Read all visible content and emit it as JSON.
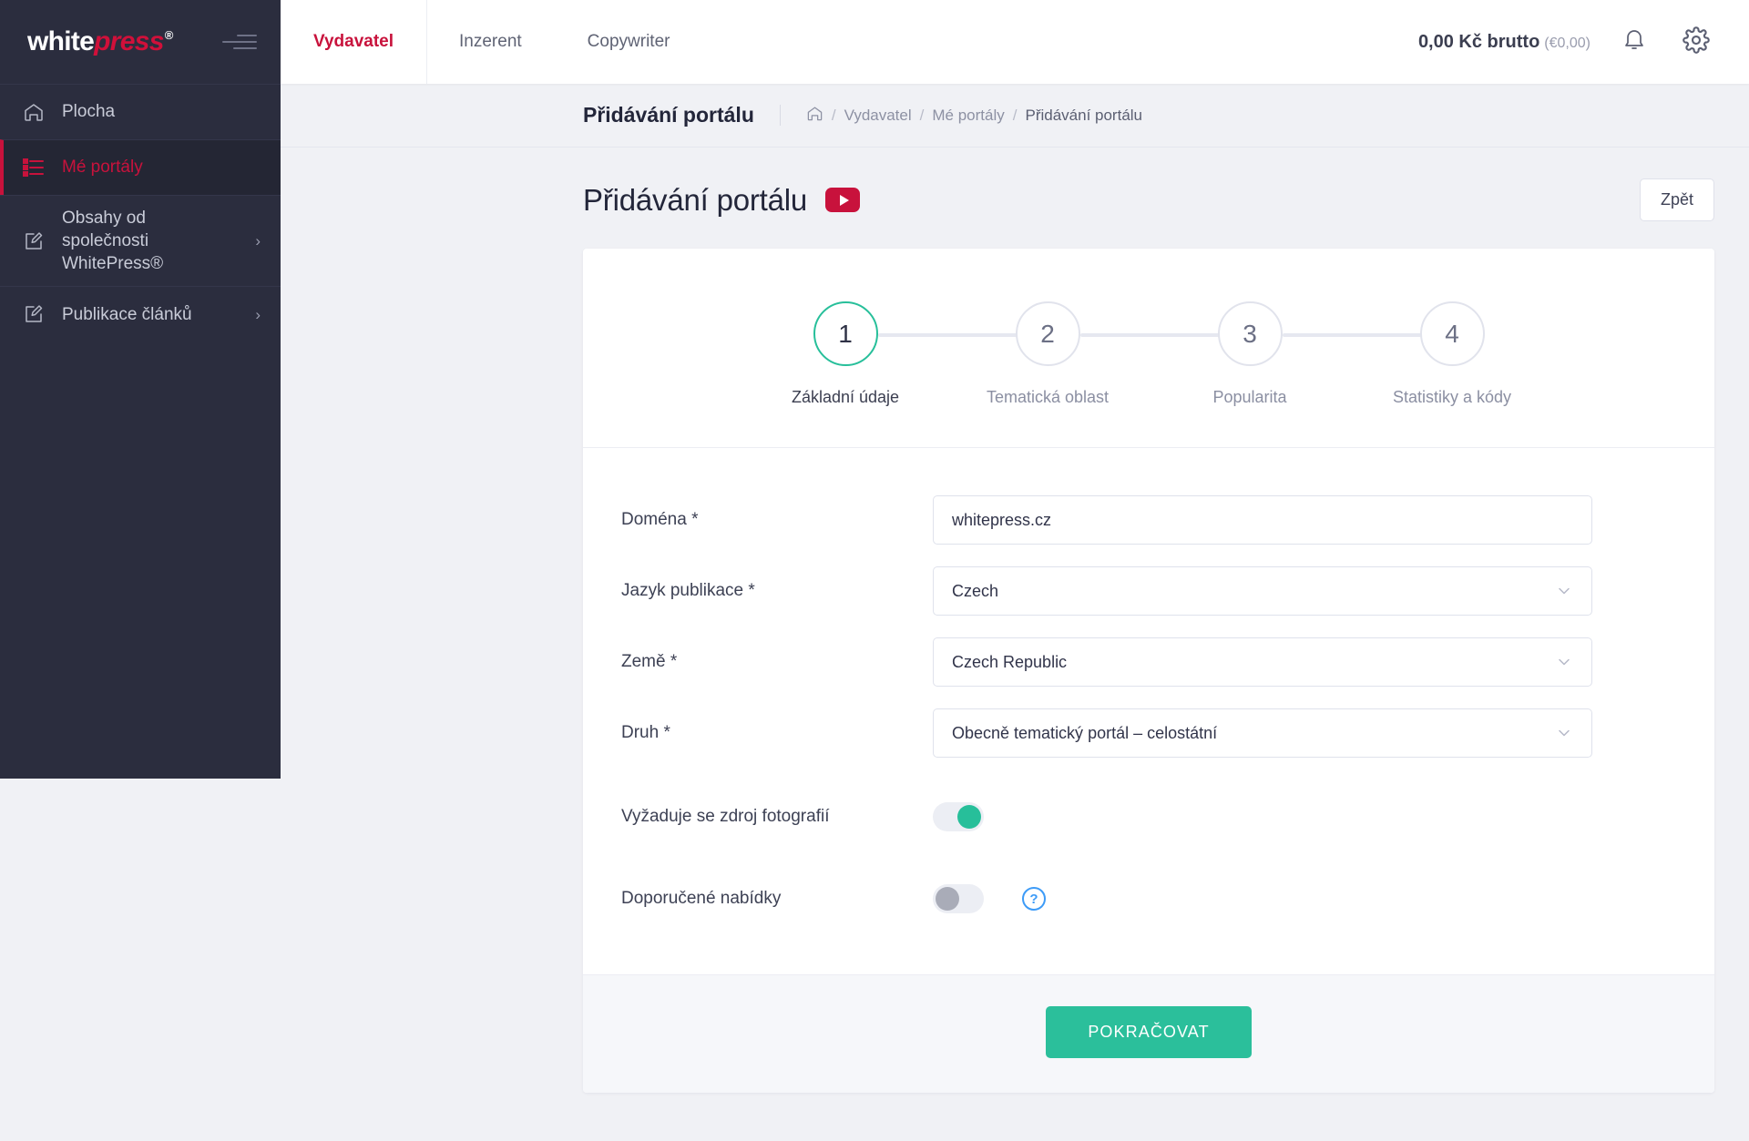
{
  "brand": {
    "logo_white": "white",
    "logo_press": "press",
    "logo_reg": "®",
    "accent_red": "#c8123c",
    "accent_green": "#2bbf9b",
    "sidebar_bg": "#2b2d3e"
  },
  "sidebar": {
    "menu_icon": "hamburger-icon",
    "items": [
      {
        "label": "Plocha",
        "icon": "home-icon",
        "active": false,
        "has_chevron": false
      },
      {
        "label": "Mé portály",
        "icon": "list-icon",
        "active": true,
        "has_chevron": false
      },
      {
        "label": "Obsahy od společnosti WhitePress®",
        "icon": "edit-icon",
        "active": false,
        "has_chevron": true,
        "chevron": "›"
      },
      {
        "label": "Publikace článků",
        "icon": "edit-icon",
        "active": false,
        "has_chevron": true,
        "chevron": "›"
      }
    ]
  },
  "topbar": {
    "tabs": [
      {
        "label": "Vydavatel",
        "active": true
      },
      {
        "label": "Inzerent",
        "active": false
      },
      {
        "label": "Copywriter",
        "active": false
      }
    ],
    "balance": "0,00 Kč brutto",
    "balance_secondary": "(€0,00)",
    "notification_icon": "bell-icon",
    "settings_icon": "gear-icon"
  },
  "page_band": {
    "title": "Přidávání portálu",
    "breadcrumb": {
      "home_icon": "home-icon",
      "items": [
        "Vydavatel",
        "Mé portály"
      ],
      "current": "Přidávání portálu",
      "separator": "/"
    }
  },
  "header": {
    "title": "Přidávání portálu",
    "video_icon": "youtube-play-icon",
    "back_label": "Zpět"
  },
  "stepper": {
    "steps": [
      {
        "number": "1",
        "label": "Základní údaje",
        "active": true
      },
      {
        "number": "2",
        "label": "Tematická oblast",
        "active": false
      },
      {
        "number": "3",
        "label": "Popularita",
        "active": false
      },
      {
        "number": "4",
        "label": "Statistiky a kódy",
        "active": false
      }
    ]
  },
  "form": {
    "fields": [
      {
        "label": "Doména *",
        "value": "whitepress.cz",
        "type": "text",
        "name": "domain"
      },
      {
        "label": "Jazyk publikace *",
        "value": "Czech",
        "type": "select",
        "name": "publication-language"
      },
      {
        "label": "Země *",
        "value": "Czech Republic",
        "type": "select",
        "name": "country"
      },
      {
        "label": "Druh *",
        "value": "Obecně tematický portál – celostátní",
        "type": "select",
        "name": "portal-type"
      }
    ],
    "toggles": [
      {
        "label": "Vyžaduje se zdroj fotografií",
        "on": true,
        "name": "photo-source-required",
        "help": false
      },
      {
        "label": "Doporučené nabídky",
        "on": false,
        "name": "recommended-offers",
        "help": true,
        "help_glyph": "?"
      }
    ],
    "chevron_icon": "chevron-down-icon"
  },
  "footer": {
    "submit_label": "POKRAČOVAT"
  }
}
